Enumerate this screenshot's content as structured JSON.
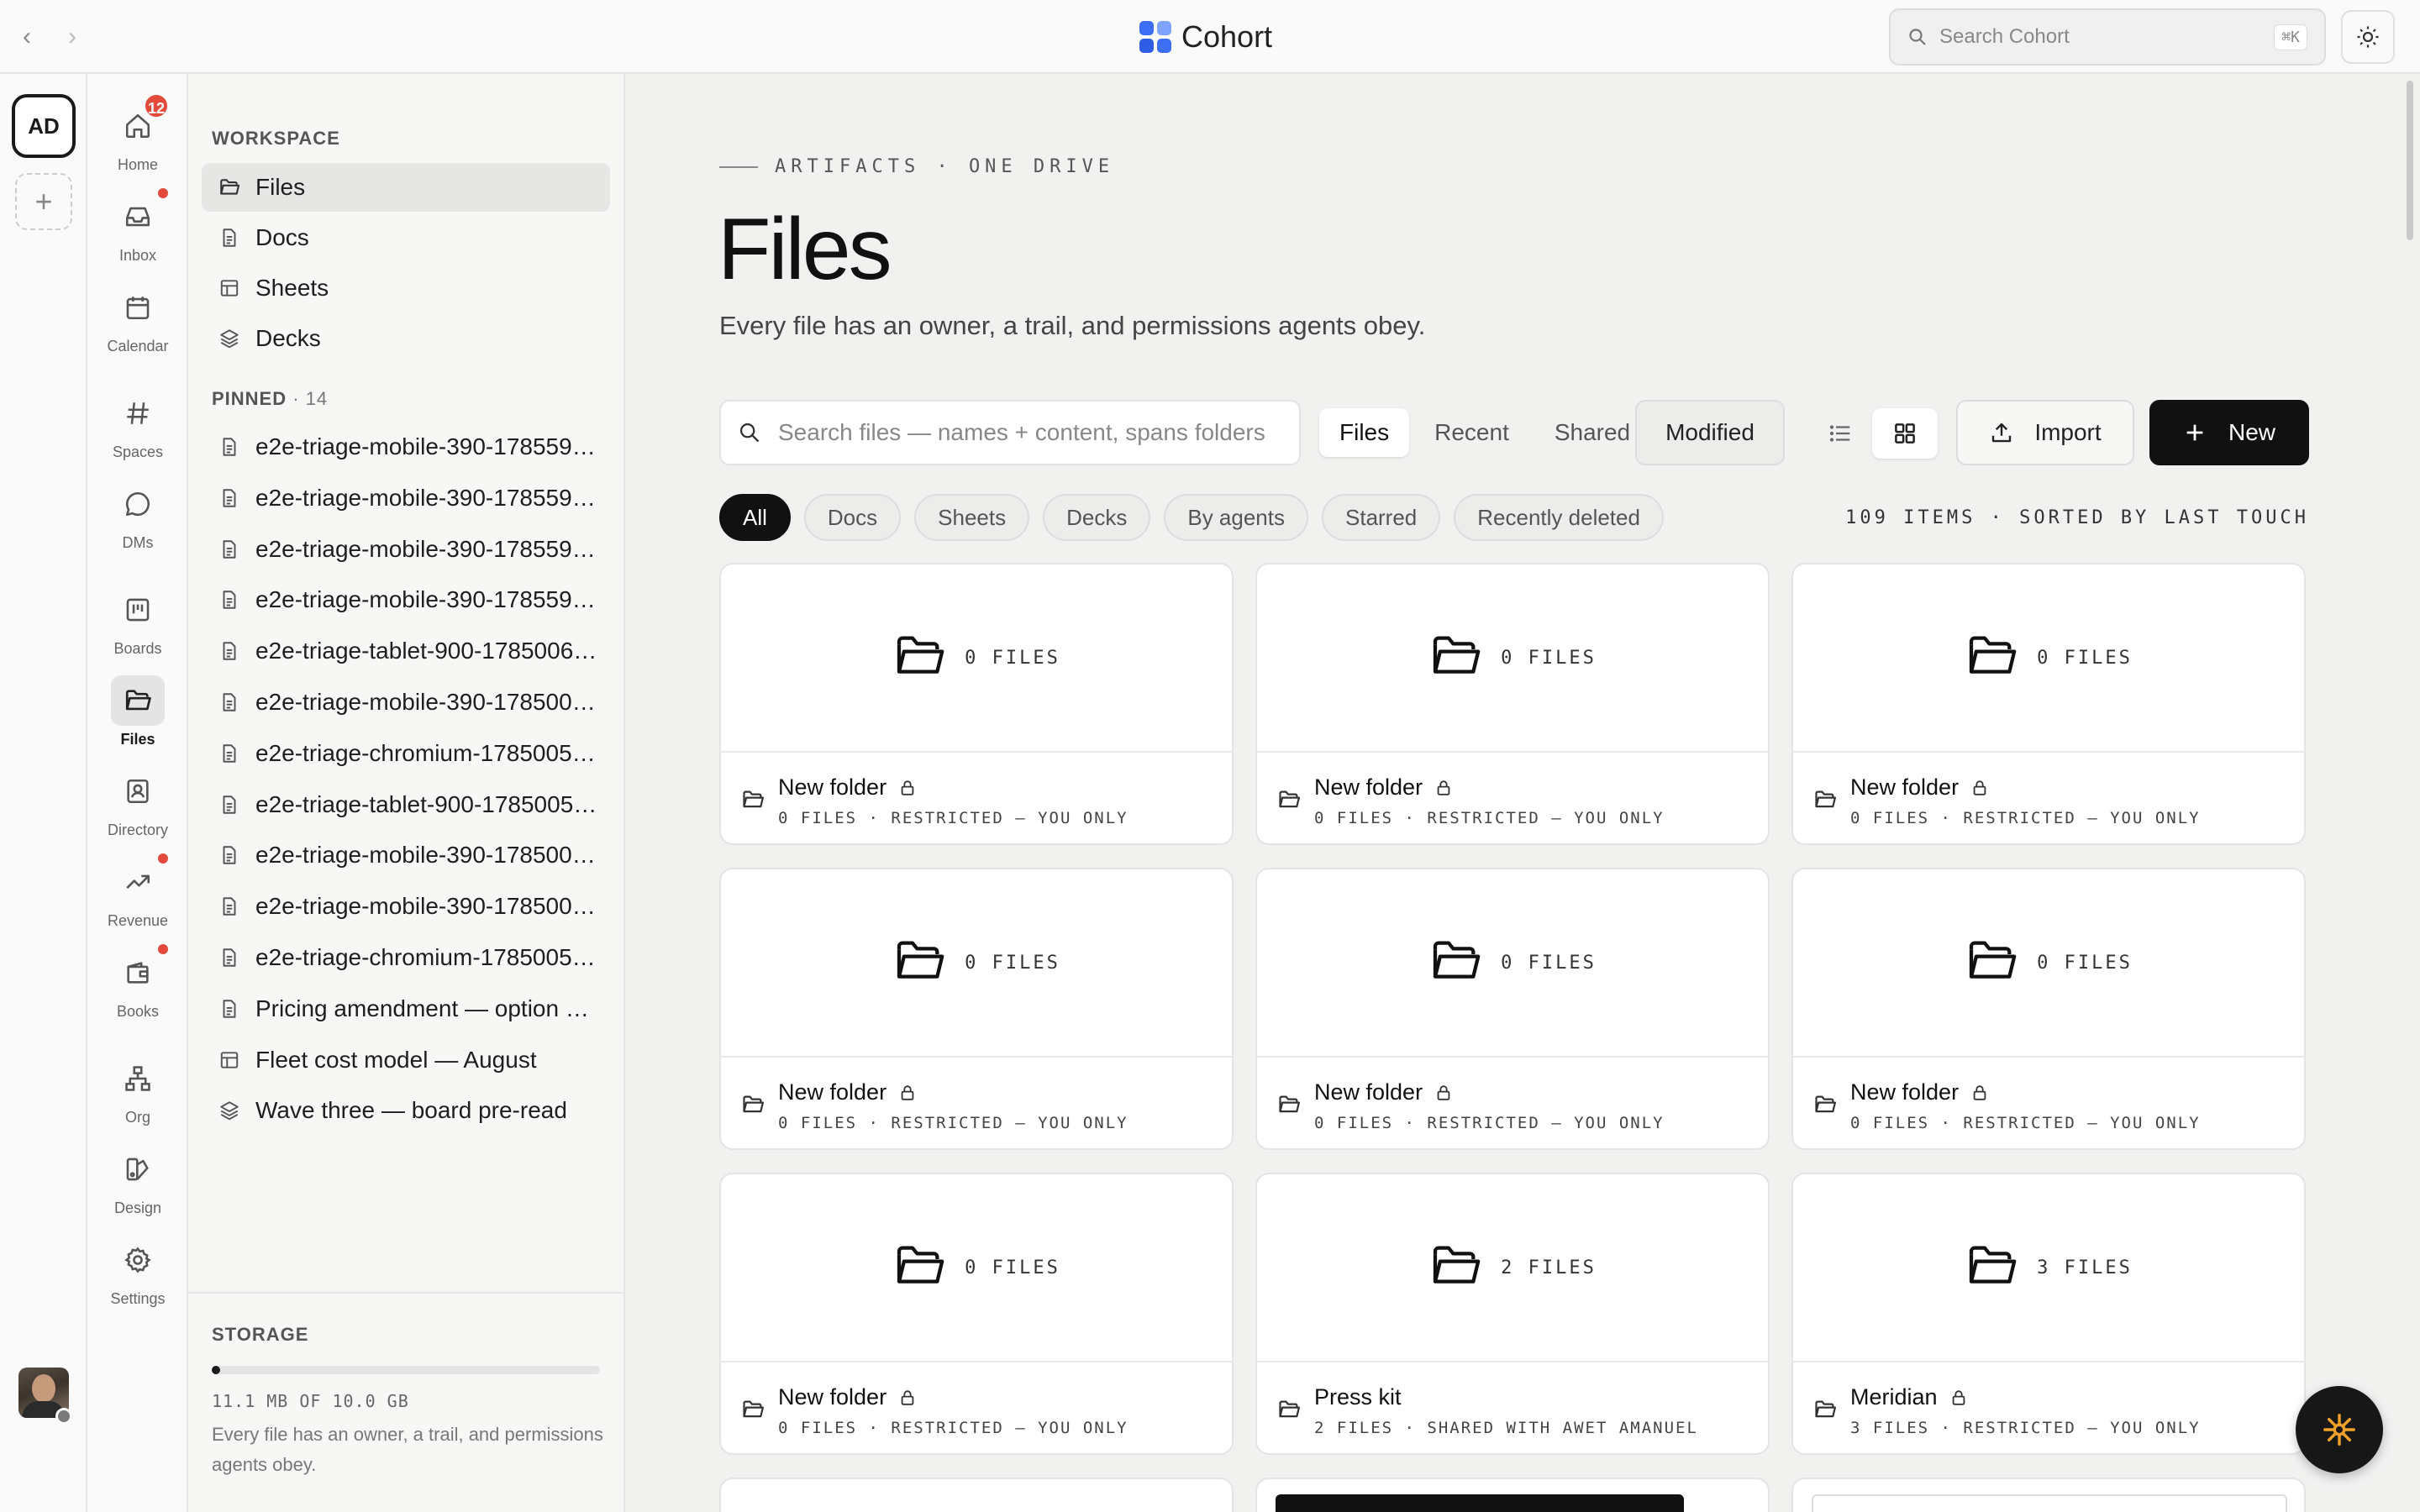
{
  "topbar": {
    "brand": "Cohort",
    "search_placeholder": "Search Cohort",
    "search_shortcut": "⌘K",
    "back_glyph": "‹",
    "forward_glyph": "›"
  },
  "rail": {
    "workspace_initials": "AD",
    "add_glyph": "+"
  },
  "appnav": [
    {
      "label": "Home",
      "icon": "home-icon",
      "badge": "12"
    },
    {
      "label": "Inbox",
      "icon": "inbox-icon",
      "dot": true
    },
    {
      "label": "Calendar",
      "icon": "calendar-icon"
    },
    {
      "label": "Spaces",
      "icon": "hash-icon"
    },
    {
      "label": "DMs",
      "icon": "chat-icon"
    },
    {
      "label": "Boards",
      "icon": "board-icon"
    },
    {
      "label": "Files",
      "icon": "folder-icon",
      "active": true
    },
    {
      "label": "Directory",
      "icon": "contact-icon"
    },
    {
      "label": "Revenue",
      "icon": "trend-icon",
      "dot": true
    },
    {
      "label": "Books",
      "icon": "wallet-icon",
      "dot": true
    },
    {
      "label": "Org",
      "icon": "org-icon"
    },
    {
      "label": "Design",
      "icon": "design-icon"
    },
    {
      "label": "Settings",
      "icon": "gear-icon"
    }
  ],
  "sidebar": {
    "workspace_title": "WORKSPACE",
    "workspace_items": [
      {
        "label": "Files",
        "icon": "folder",
        "active": true
      },
      {
        "label": "Docs",
        "icon": "doc"
      },
      {
        "label": "Sheets",
        "icon": "sheet"
      },
      {
        "label": "Decks",
        "icon": "deck"
      }
    ],
    "pinned_title": "PINNED",
    "pinned_count": "· 14",
    "pinned_items": [
      {
        "label": "e2e-triage-mobile-390-178559…",
        "icon": "doc"
      },
      {
        "label": "e2e-triage-mobile-390-178559…",
        "icon": "doc"
      },
      {
        "label": "e2e-triage-mobile-390-178559…",
        "icon": "doc"
      },
      {
        "label": "e2e-triage-mobile-390-178559…",
        "icon": "doc"
      },
      {
        "label": "e2e-triage-tablet-900-1785006…",
        "icon": "doc"
      },
      {
        "label": "e2e-triage-mobile-390-178500…",
        "icon": "doc"
      },
      {
        "label": "e2e-triage-chromium-1785005…",
        "icon": "doc"
      },
      {
        "label": "e2e-triage-tablet-900-1785005…",
        "icon": "doc"
      },
      {
        "label": "e2e-triage-mobile-390-178500…",
        "icon": "doc"
      },
      {
        "label": "e2e-triage-mobile-390-178500…",
        "icon": "doc"
      },
      {
        "label": "e2e-triage-chromium-17850051…",
        "icon": "doc"
      },
      {
        "label": "Pricing amendment — option B …",
        "icon": "doc"
      },
      {
        "label": "Fleet cost model — August",
        "icon": "sheet"
      },
      {
        "label": "Wave three — board pre-read",
        "icon": "deck"
      }
    ],
    "storage": {
      "title": "STORAGE",
      "usage": "11.1 MB OF 10.0 GB",
      "fraction": 0.0011,
      "note": "Every file has an owner, a trail, and permissions agents obey."
    }
  },
  "main": {
    "eyebrow": "ARTIFACTS · ONE DRIVE",
    "title": "Files",
    "subtitle": "Every file has an owner, a trail, and permissions agents obey.",
    "search_placeholder": "Search files — names + content, spans folders",
    "segments": [
      {
        "label": "Files",
        "active": true
      },
      {
        "label": "Recent"
      },
      {
        "label": "Shared"
      }
    ],
    "sort_label": "Modified",
    "import_label": "Import",
    "new_label": "New",
    "filters": [
      {
        "label": "All",
        "active": true
      },
      {
        "label": "Docs"
      },
      {
        "label": "Sheets"
      },
      {
        "label": "Decks"
      },
      {
        "label": "By agents"
      },
      {
        "label": "Starred"
      },
      {
        "label": "Recently deleted"
      }
    ],
    "items_meta": "109 ITEMS · SORTED BY LAST TOUCH",
    "cards": [
      {
        "count": "0 FILES",
        "name": "New folder",
        "locked": true,
        "meta": "0 FILES · RESTRICTED — YOU ONLY"
      },
      {
        "count": "0 FILES",
        "name": "New folder",
        "locked": true,
        "meta": "0 FILES · RESTRICTED — YOU ONLY"
      },
      {
        "count": "0 FILES",
        "name": "New folder",
        "locked": true,
        "meta": "0 FILES · RESTRICTED — YOU ONLY"
      },
      {
        "count": "0 FILES",
        "name": "New folder",
        "locked": true,
        "meta": "0 FILES · RESTRICTED — YOU ONLY"
      },
      {
        "count": "0 FILES",
        "name": "New folder",
        "locked": true,
        "meta": "0 FILES · RESTRICTED — YOU ONLY"
      },
      {
        "count": "0 FILES",
        "name": "New folder",
        "locked": true,
        "meta": "0 FILES · RESTRICTED — YOU ONLY"
      },
      {
        "count": "0 FILES",
        "name": "New folder",
        "locked": true,
        "meta": "0 FILES · RESTRICTED — YOU ONLY"
      },
      {
        "count": "2 FILES",
        "name": "Press kit",
        "locked": false,
        "meta": "2 FILES · SHARED WITH AWET AMANUEL"
      },
      {
        "count": "3 FILES",
        "name": "Meridian",
        "locked": true,
        "meta": "3 FILES · RESTRICTED — YOU ONLY"
      }
    ]
  },
  "colors": {
    "accent": "#3d6ff5",
    "badge": "#e24a3b",
    "dark": "#111111",
    "fab_spark": "#f0a02a"
  }
}
